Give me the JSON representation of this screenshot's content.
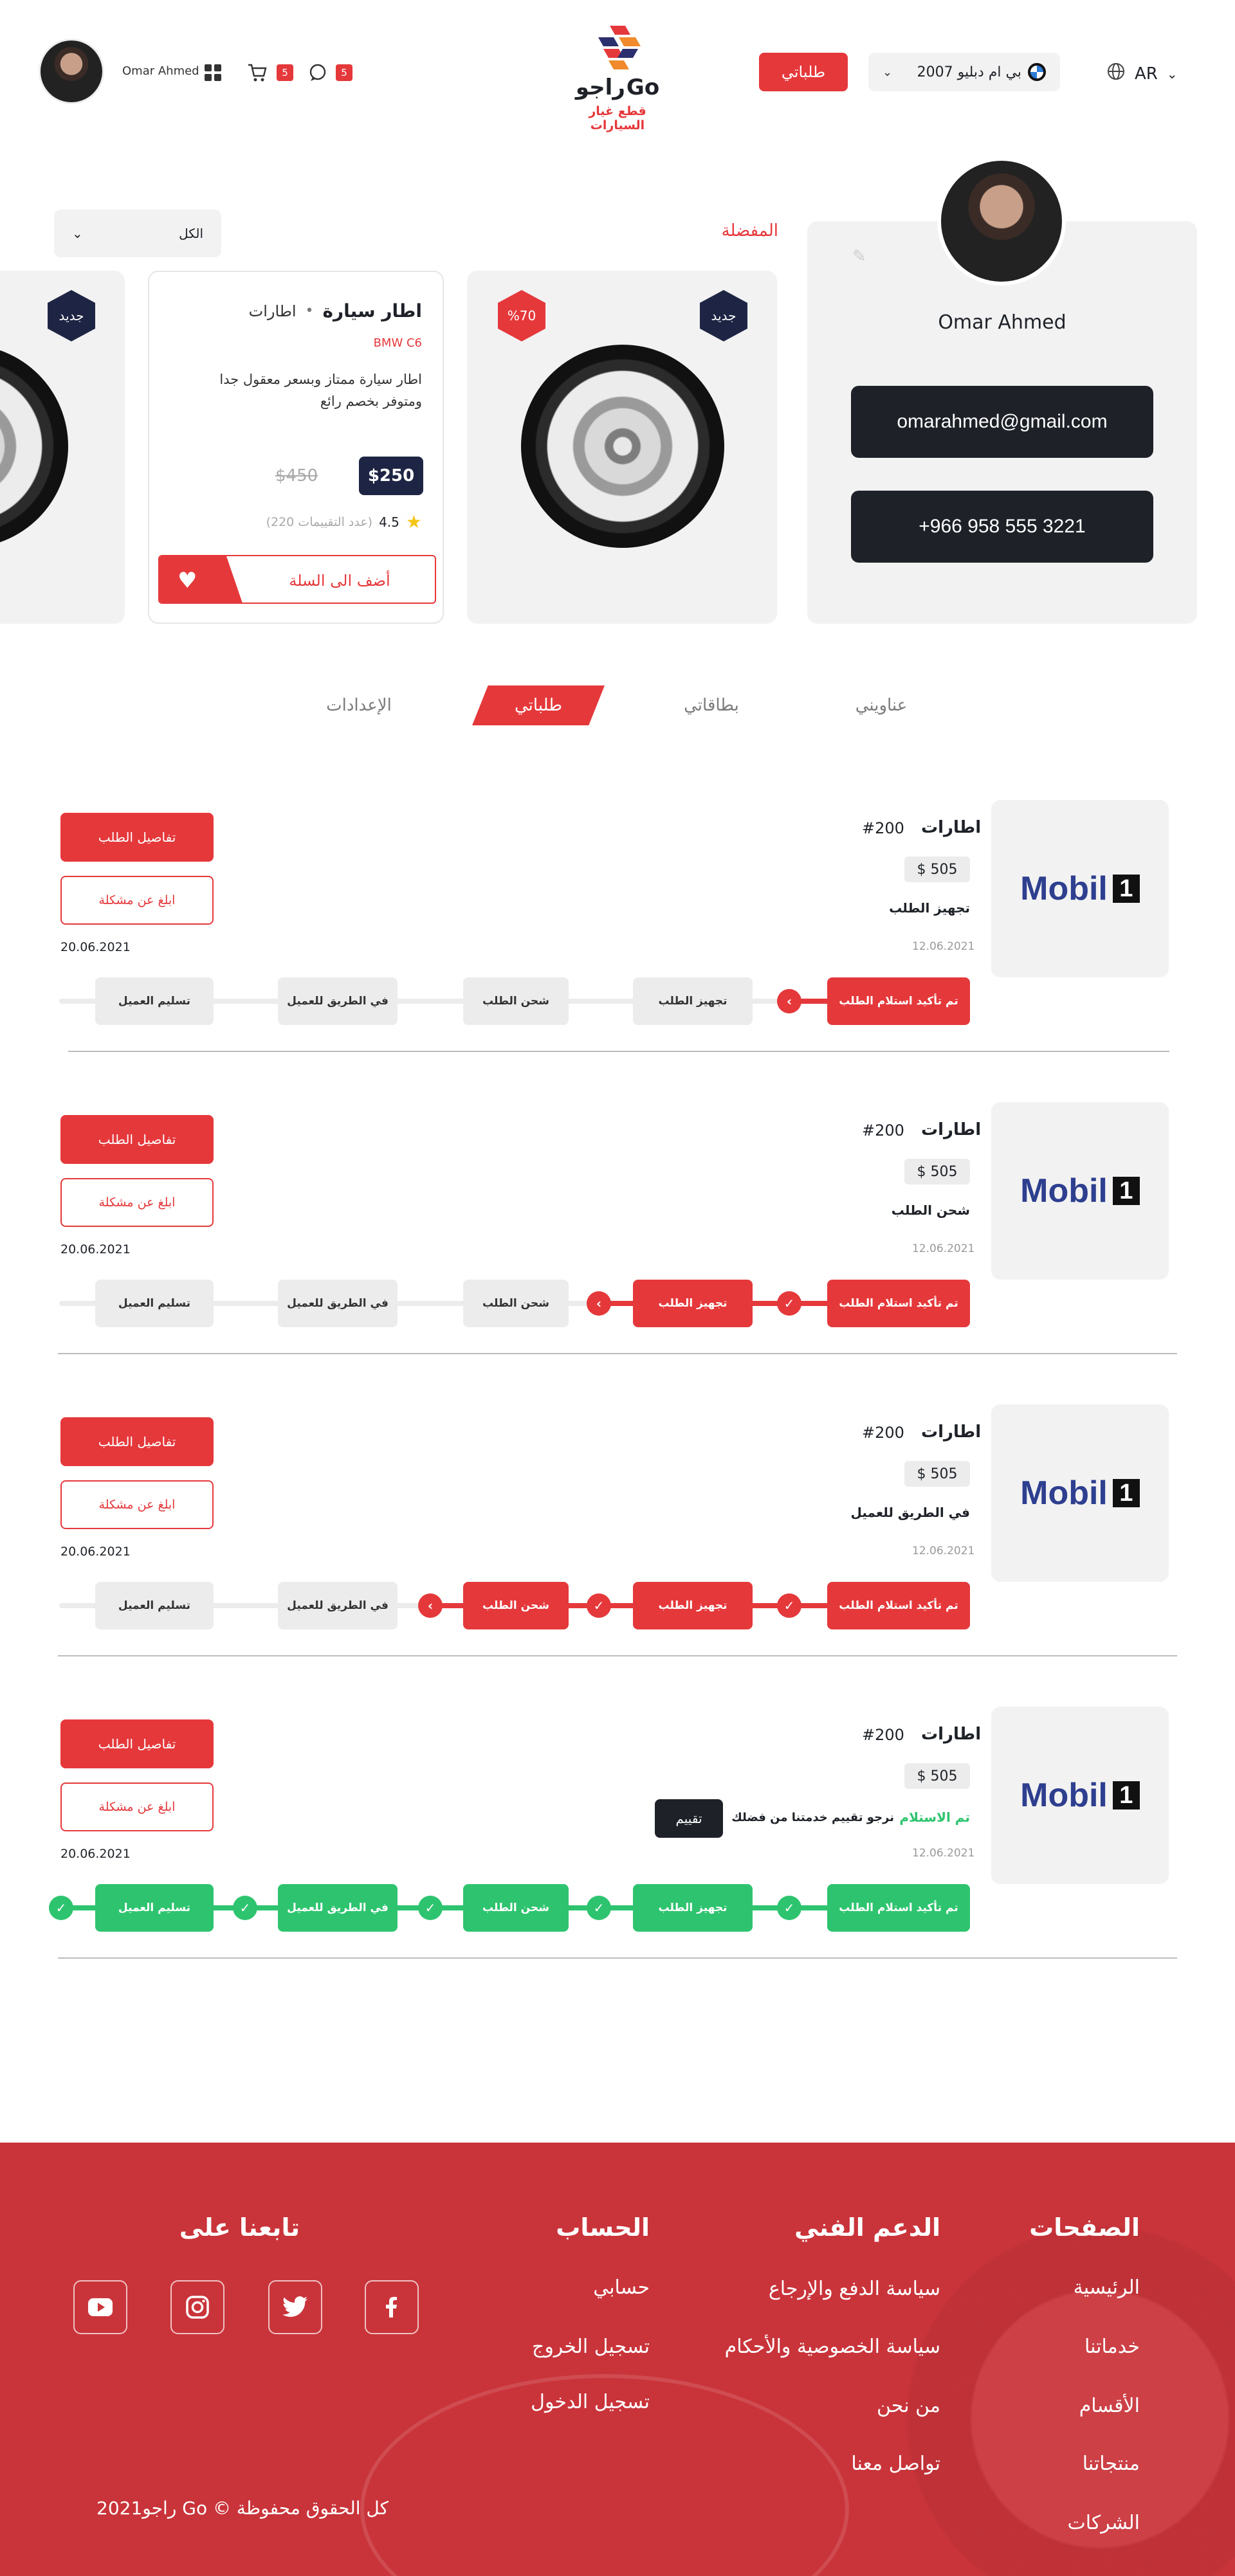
{
  "header": {
    "user_name": "Omar Ahmed",
    "cart_count": "5",
    "messages_count": "5",
    "logo_latin": "Go",
    "logo_arabic": "راجو",
    "logo_tagline": "قطع غيار السيارات",
    "orders_button": "طلباتي",
    "car_select": "بي ام دبليو 2007",
    "language": "AR",
    "icons": [
      "grid-icon",
      "cart-icon",
      "chat-icon",
      "bmw-logo",
      "globe-icon",
      "chevron-down-icon"
    ]
  },
  "profile": {
    "name": "Omar Ahmed",
    "email": "omarahmed@gmail.com",
    "phone": "+966 958 555 3221"
  },
  "favorites": {
    "title": "المفضلة",
    "filter": "الكل"
  },
  "products": [
    {
      "badge": "جديد",
      "discount": "%70"
    },
    {
      "title": "اطار سيارة",
      "category": "اطارات",
      "model": "BMW C6",
      "description": "اطار سيارة ممتاز وبسعر معقول جدا ومتوفر بخصم رائع",
      "price": "$250",
      "old_price": "$450",
      "rating": "4.5",
      "ratings_count": "(عدد التقييمات 220)",
      "add_to_cart": "أضف الى السلة"
    },
    {
      "badge": "جديد"
    }
  ],
  "tabs": [
    "عناويني",
    "بطاقاتي",
    "طلباتي",
    "الإعدادات"
  ],
  "orders": [
    {
      "category": "اطارات",
      "qty": "#200",
      "price": "$ 505",
      "status": "تجهيز الطلب",
      "date_start": "12.06.2021",
      "date_end": "20.06.2021",
      "details_btn": "تفاصيل الطلب",
      "report_btn": "ابلغ عن مشكلة"
    },
    {
      "category": "اطارات",
      "qty": "#200",
      "price": "$ 505",
      "status": "شحن الطلب",
      "date_start": "12.06.2021",
      "date_end": "20.06.2021",
      "details_btn": "تفاصيل الطلب",
      "report_btn": "ابلغ عن مشكلة"
    },
    {
      "category": "اطارات",
      "qty": "#200",
      "price": "$ 505",
      "status": "في الطريق للعميل",
      "date_start": "12.06.2021",
      "date_end": "20.06.2021",
      "details_btn": "تفاصيل الطلب",
      "report_btn": "ابلغ عن مشكلة"
    },
    {
      "category": "اطارات",
      "qty": "#200",
      "price": "$ 505",
      "status": "تم الاستلام",
      "rate_prompt": "نرجو تقييم خدمتنا من فضلك",
      "rate_btn": "تقييم",
      "date_start": "12.06.2021",
      "date_end": "20.06.2021",
      "details_btn": "تفاصيل الطلب",
      "report_btn": "ابلغ عن مشكلة"
    }
  ],
  "order_steps": [
    "تم تأكيد استلام الطلب",
    "تجهيز الطلب",
    "شحن الطلب",
    "في الطريق للعميل",
    "تسليم العميل"
  ],
  "order_brand": {
    "word": "Mobil",
    "digit": "1"
  },
  "footer": {
    "pages_title": "الصفحات",
    "pages": [
      "الرئيسية",
      "خدماتنا",
      "الأقسام",
      "منتجاتنا",
      "الشركات"
    ],
    "support_title": "الدعم الفني",
    "support": [
      "سياسة الدفع والإرجاع",
      "سياسة الخصوصية والأحكام",
      "من نحن",
      "تواصل معنا"
    ],
    "account_title": "الحساب",
    "account": [
      "حسابي",
      "تسجيل الخروج",
      "تسجيل الدخول"
    ],
    "follow_title": "تابعنا على",
    "copyright": "كل الحقوق محفوظة © Go راجو2021"
  },
  "colors": {
    "accent": "#e5383b",
    "dark": "#1e2228",
    "green": "#2ec46f",
    "footer_bg": "#c9343a"
  }
}
